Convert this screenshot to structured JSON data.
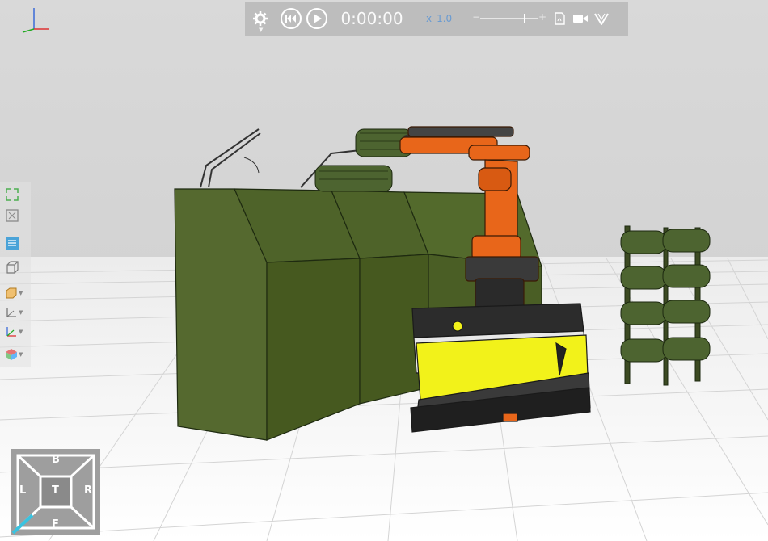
{
  "toolbar": {
    "settings_icon": "gear-icon",
    "rewind_icon": "skip-back-icon",
    "play_icon": "play-icon",
    "time": "0:00:00",
    "speed_prefix": "x",
    "speed_value": "1.0",
    "speed_slider_fraction": 0.75,
    "slider_minus": "−",
    "slider_plus": "+",
    "pdf_icon": "pdf-export-icon",
    "record_icon": "video-camera-icon",
    "logo_icon": "app-logo-icon"
  },
  "left_toolbar": {
    "items": [
      {
        "icon": "fit-view-icon"
      },
      {
        "icon": "zoom-extents-icon"
      },
      {
        "icon": "layer-panel-icon"
      },
      {
        "icon": "box-view-icon"
      },
      {
        "icon": "projection-icon"
      },
      {
        "icon": "axis-display-icon"
      },
      {
        "icon": "axis-color-icon"
      },
      {
        "icon": "render-mode-icon"
      }
    ]
  },
  "nav_cube": {
    "top": "B",
    "left": "L",
    "center": "T",
    "right": "R",
    "bottom": "F"
  },
  "colors": {
    "toolbar_bg": "#bdbdbd",
    "machine_green": "#4a5e2a",
    "robot_orange": "#e8661a",
    "agv_yellow": "#f2f21a",
    "accent_blue": "#6a9bd1",
    "navcube_accent": "#39c3e0"
  }
}
